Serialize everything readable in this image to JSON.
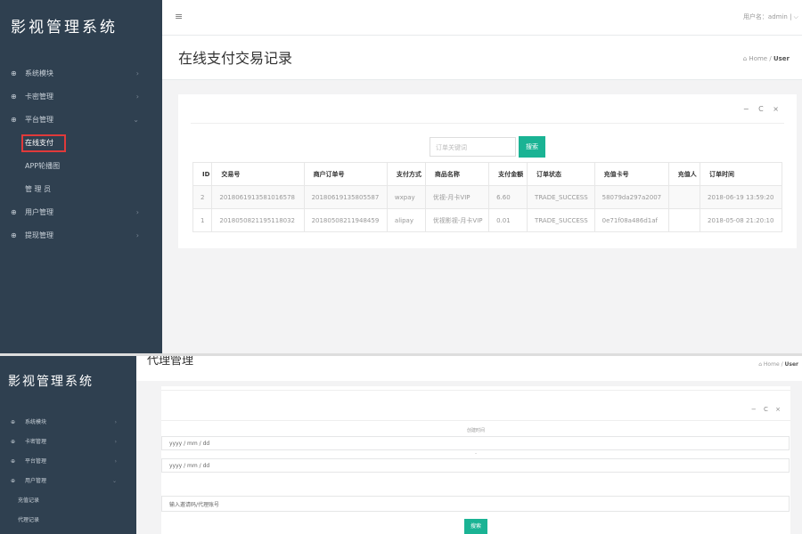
{
  "shot1": {
    "brand": "影视管理系统",
    "nav": [
      {
        "label": "系统模块",
        "chevron": "›"
      },
      {
        "label": "卡密管理",
        "chevron": "›"
      },
      {
        "label": "平台管理",
        "chevron": "⌄"
      }
    ],
    "sub_items": [
      {
        "label": "在线支付"
      },
      {
        "label": "APP轮播图"
      },
      {
        "label": "管 理 员"
      }
    ],
    "nav_after": [
      {
        "label": "用户管理",
        "chevron": "›"
      },
      {
        "label": "提现管理",
        "chevron": "›"
      }
    ],
    "topbar": {
      "menu_icon": "≡",
      "user_text": "用户名：admin  |  ⌵"
    },
    "page_title": "在线支付交易记录",
    "breadcrumb": {
      "home": "⌂ Home",
      "sep": "/",
      "current": "User"
    },
    "panel_tools": "− C ×",
    "search": {
      "placeholder": "订单关键词",
      "button": "搜索"
    },
    "table": {
      "headers": [
        "ID",
        "交易号",
        "商户订单号",
        "支付方式",
        "商品名称",
        "支付金额",
        "订单状态",
        "充值卡号",
        "充值人",
        "订单时间"
      ],
      "rows": [
        [
          "2",
          "2018061913581016578",
          "20180619135805587",
          "wxpay",
          "优视-月卡VIP",
          "6.60",
          "TRADE_SUCCESS",
          "58079da297a2007",
          "",
          "2018-06-19 13:59:20"
        ],
        [
          "1",
          "2018050821195118032",
          "20180508211948459",
          "alipay",
          "优视影视-月卡VIP",
          "0.01",
          "TRADE_SUCCESS",
          "0e71f08a486d1af",
          "",
          "2018-05-08 21:20:10"
        ]
      ]
    }
  },
  "shot2": {
    "brand": "影视管理系统",
    "nav": [
      {
        "label": "系统模块",
        "chevron": "›"
      },
      {
        "label": "卡密管理",
        "chevron": "›"
      },
      {
        "label": "平台管理",
        "chevron": "›"
      },
      {
        "label": "用户管理",
        "chevron": "⌄"
      }
    ],
    "sub_items": [
      {
        "label": "充值记录"
      },
      {
        "label": "代理记录"
      }
    ],
    "page_title": "代理管理",
    "breadcrumb": {
      "home": "⌂ Home",
      "sep": "/",
      "current": "User"
    },
    "panel_tools": "− C ×",
    "form": {
      "time_label": "创建时间",
      "date_start_placeholder": "yyyy / mm / dd",
      "dash": "-",
      "date_end_placeholder": "yyyy / mm / dd",
      "code_placeholder": "输入邀请码/代理账号",
      "search_button": "搜索"
    }
  }
}
